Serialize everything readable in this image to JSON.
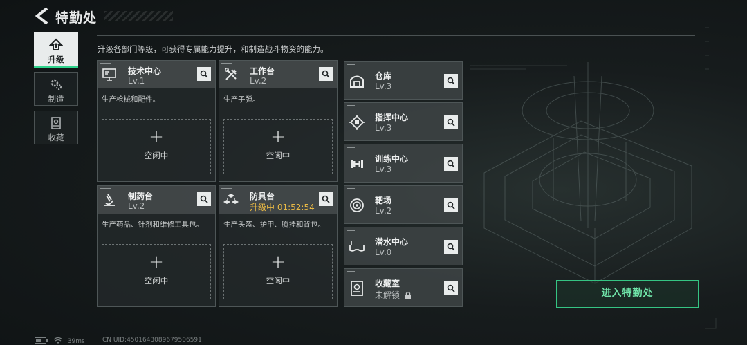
{
  "header": {
    "title": "特勤处"
  },
  "description": "升级各部门等级，可获得专属能力提升，和制造战斗物资的能力。",
  "tabs": [
    {
      "label": "升级",
      "icon": "upgrade-icon",
      "active": true
    },
    {
      "label": "制造",
      "icon": "gears-icon",
      "active": false
    },
    {
      "label": "收藏",
      "icon": "collection-icon",
      "active": false
    }
  ],
  "cards": [
    {
      "name": "技术中心",
      "level": "Lv.1",
      "desc": "生产枪械和配件。",
      "slot_label": "空闲中",
      "icon": "monitor-icon"
    },
    {
      "name": "工作台",
      "level": "Lv.2",
      "desc": "生产子弹。",
      "slot_label": "空闲中",
      "icon": "tools-icon"
    },
    {
      "name": "制药台",
      "level": "Lv.2",
      "desc": "生产药品、针剂和维修工具包。",
      "slot_label": "空闲中",
      "icon": "microscope-icon"
    },
    {
      "name": "防具台",
      "level": "升级中 01:52:54",
      "desc": "生产头盔、护甲、胸挂和背包。",
      "slot_label": "空闲中",
      "icon": "cubes-icon"
    }
  ],
  "facilities": [
    {
      "name": "仓库",
      "level": "Lv.3",
      "icon": "warehouse-icon"
    },
    {
      "name": "指挥中心",
      "level": "Lv.3",
      "icon": "chip-icon"
    },
    {
      "name": "训练中心",
      "level": "Lv.3",
      "icon": "dumbbell-icon"
    },
    {
      "name": "靶场",
      "level": "Lv.2",
      "icon": "target-icon"
    },
    {
      "name": "潜水中心",
      "level": "Lv.0",
      "icon": "goggles-icon"
    },
    {
      "name": "收藏室",
      "level": "未解锁",
      "icon": "vault-icon",
      "locked": true
    }
  ],
  "enter_button": "进入特勤处",
  "footer": {
    "ping": "39ms",
    "uid": "CN UID:4501643089679506591"
  },
  "colors": {
    "accent": "#35c483",
    "upgrading": "#e7b845",
    "panel": "#3e4445"
  }
}
